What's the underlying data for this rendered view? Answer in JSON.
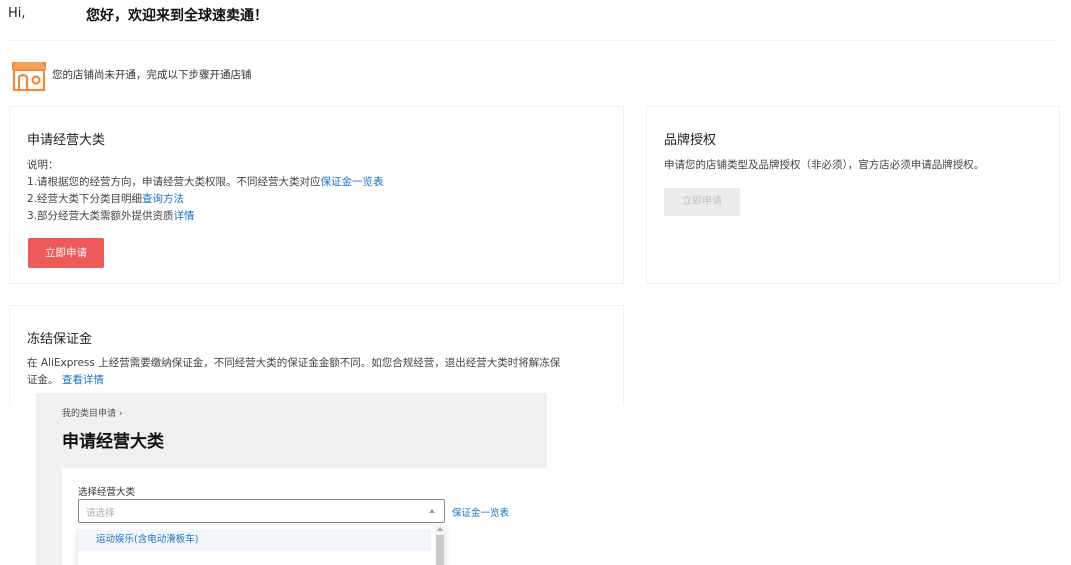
{
  "header": {
    "greeting": "Hi,",
    "title": "您好，欢迎来到全球速卖通！"
  },
  "store_notice": {
    "icon": "store-icon",
    "text": "您的店铺尚未开通，完成以下步骤开通店铺"
  },
  "apply_card": {
    "title": "申请经营大类",
    "desc_heading": "说明：",
    "line1_text": "1.请根据您的经营方向，申请经营大类权限。不同经营大类对应",
    "line1_link": "保证金一览表",
    "line2_text": "2.经营大类下分类目明细",
    "line2_link": "查询方法",
    "line3_text": "3.部分经营大类需额外提供资质",
    "line3_link": "详情",
    "button_label": "立即申请"
  },
  "brand_card": {
    "title": "品牌授权",
    "desc": "申请您的店铺类型及品牌授权（非必须），官方店必须申请品牌授权。",
    "button_label": "立即申请"
  },
  "deposit_card": {
    "title": "冻结保证金",
    "desc_line1": "在 AliExpress 上经营需要缴纳保证金，不同经营大类的保证金金额不同。如您合规经营，退出经营大类时将解冻保",
    "desc_line2": "证金。",
    "link": "查看详情"
  },
  "embedded_screenshot": {
    "breadcrumb": "我的类目申请 ›",
    "title": "申请经营大类",
    "field_label": "选择经营大类",
    "select_placeholder": "请选择",
    "deposit_link": "保证金一览表",
    "options": [
      "运动娱乐(含电动滑板车)"
    ]
  },
  "colors": {
    "primary_button": "#ee5a5a",
    "link": "#1a73c9",
    "disabled_button": "#ececec",
    "store_icon": "#f08a3c"
  }
}
